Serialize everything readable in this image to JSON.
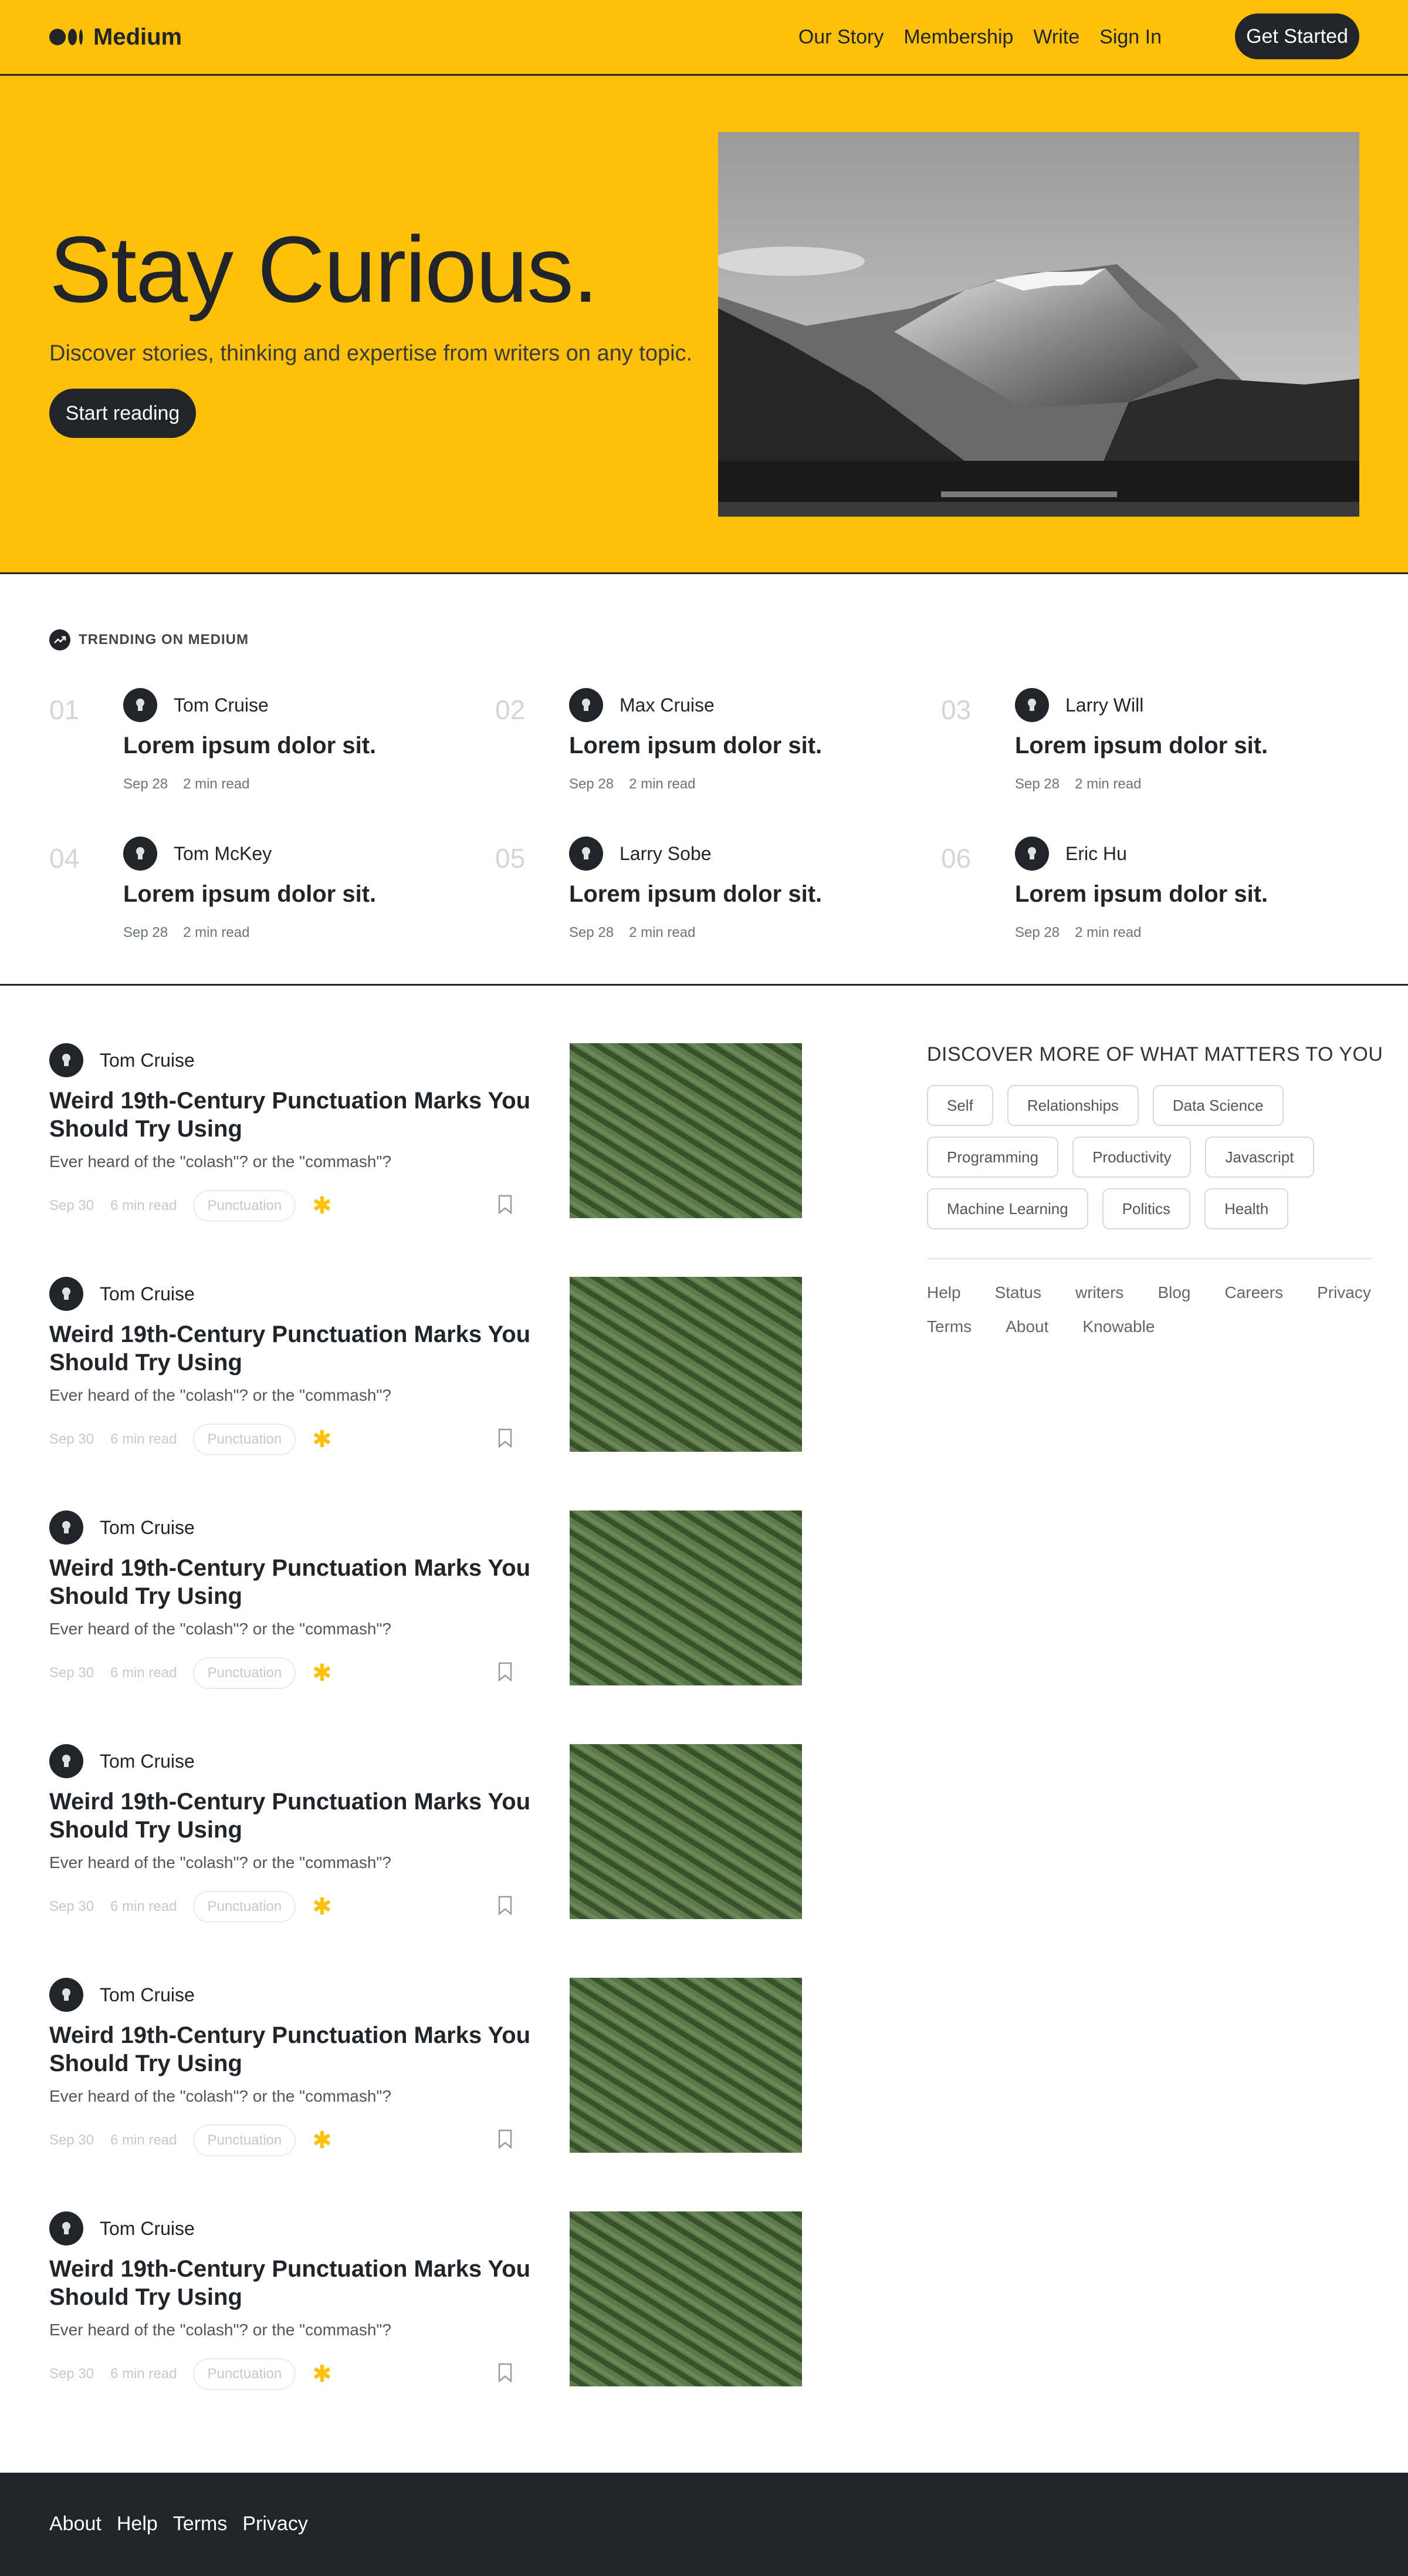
{
  "header": {
    "brand": "Medium",
    "nav": [
      "Our Story",
      "Membership",
      "Write",
      "Sign In"
    ],
    "cta": "Get Started"
  },
  "hero": {
    "title": "Stay Curious.",
    "subtitle": "Discover stories, thinking and expertise from writers on any topic.",
    "button": "Start reading"
  },
  "trending": {
    "label": "TRENDING ON MEDIUM",
    "items": [
      {
        "num": "01",
        "author": "Tom Cruise",
        "title": "Lorem ipsum dolor sit.",
        "date": "Sep 28",
        "read": "2 min read"
      },
      {
        "num": "02",
        "author": "Max Cruise",
        "title": "Lorem ipsum dolor sit.",
        "date": "Sep 28",
        "read": "2 min read"
      },
      {
        "num": "03",
        "author": "Larry Will",
        "title": "Lorem ipsum dolor sit.",
        "date": "Sep 28",
        "read": "2 min read"
      },
      {
        "num": "04",
        "author": "Tom McKey",
        "title": "Lorem ipsum dolor sit.",
        "date": "Sep 28",
        "read": "2 min read"
      },
      {
        "num": "05",
        "author": "Larry Sobe",
        "title": "Lorem ipsum dolor sit.",
        "date": "Sep 28",
        "read": "2 min read"
      },
      {
        "num": "06",
        "author": "Eric Hu",
        "title": "Lorem ipsum dolor sit.",
        "date": "Sep 28",
        "read": "2 min read"
      }
    ]
  },
  "articles": [
    {
      "author": "Tom Cruise",
      "title": "Weird 19th-Century Punctuation Marks You Should Try Using",
      "subtitle": "Ever heard of the \"colash\"? or the \"commash\"?",
      "date": "Sep 30",
      "read": "6 min read",
      "tag": "Punctuation"
    },
    {
      "author": "Tom Cruise",
      "title": "Weird 19th-Century Punctuation Marks You Should Try Using",
      "subtitle": "Ever heard of the \"colash\"? or the \"commash\"?",
      "date": "Sep 30",
      "read": "6 min read",
      "tag": "Punctuation"
    },
    {
      "author": "Tom Cruise",
      "title": "Weird 19th-Century Punctuation Marks You Should Try Using",
      "subtitle": "Ever heard of the \"colash\"? or the \"commash\"?",
      "date": "Sep 30",
      "read": "6 min read",
      "tag": "Punctuation"
    },
    {
      "author": "Tom Cruise",
      "title": "Weird 19th-Century Punctuation Marks You Should Try Using",
      "subtitle": "Ever heard of the \"colash\"? or the \"commash\"?",
      "date": "Sep 30",
      "read": "6 min read",
      "tag": "Punctuation"
    },
    {
      "author": "Tom Cruise",
      "title": "Weird 19th-Century Punctuation Marks You Should Try Using",
      "subtitle": "Ever heard of the \"colash\"? or the \"commash\"?",
      "date": "Sep 30",
      "read": "6 min read",
      "tag": "Punctuation"
    },
    {
      "author": "Tom Cruise",
      "title": "Weird 19th-Century Punctuation Marks You Should Try Using",
      "subtitle": "Ever heard of the \"colash\"? or the \"commash\"?",
      "date": "Sep 30",
      "read": "6 min read",
      "tag": "Punctuation"
    }
  ],
  "sidebar": {
    "title": "DISCOVER MORE OF WHAT MATTERS TO YOU",
    "topics": [
      "Self",
      "Relationships",
      "Data Science",
      "Programming",
      "Productivity",
      "Javascript",
      "Machine Learning",
      "Politics",
      "Health"
    ],
    "links": [
      "Help",
      "Status",
      "writers",
      "Blog",
      "Careers",
      "Privacy",
      "Terms",
      "About",
      "Knowable"
    ]
  },
  "footer": {
    "links": [
      "About",
      "Help",
      "Terms",
      "Privacy"
    ]
  },
  "icons": {
    "logo": "medium-logo-icon",
    "trending": "trending-up-icon",
    "avatar": "user-avatar-icon",
    "bookmark": "bookmark-icon",
    "star": "star-icon"
  },
  "colors": {
    "accent": "#ffc107",
    "dark": "#212529",
    "background": "#ffffff"
  }
}
